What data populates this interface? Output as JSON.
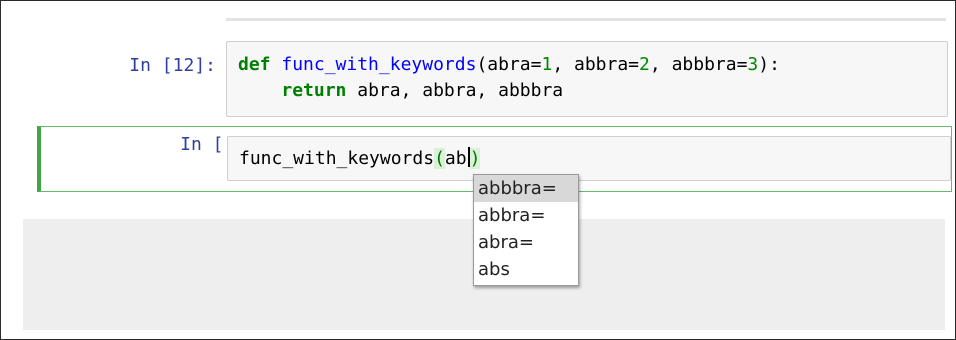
{
  "cells": [
    {
      "prompt": "In [12]:",
      "line1": {
        "def": "def",
        "name": "func_with_keywords",
        "open": "(",
        "p1": "abra=",
        "v1": "1",
        "sep1": ", ",
        "p2": "abbra=",
        "v2": "2",
        "sep2": ", ",
        "p3": "abbbra=",
        "v3": "3",
        "close": "):"
      },
      "line2": {
        "indent": "    ",
        "kw": "return",
        "rest": " abra, abbra, abbbra"
      }
    },
    {
      "prompt": "In [ ]:",
      "code_name": "func_with_keywords",
      "open_paren": "(",
      "typed": "ab",
      "close_paren": ")"
    }
  ],
  "autocomplete": {
    "items": [
      "abbbra=",
      "abbra=",
      "abra=",
      "abs"
    ],
    "selected_index": 0
  }
}
